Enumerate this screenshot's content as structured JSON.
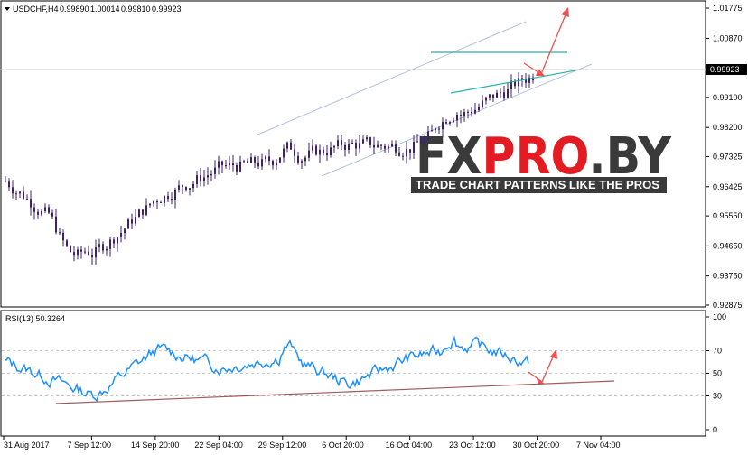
{
  "header": {
    "symbol": "USDCHF,H4",
    "open": "0.99890",
    "high": "1.00014",
    "low": "0.99810",
    "close": "0.99923",
    "current_price_label": "0.99923"
  },
  "rsi_header": "RSI(13) 50.3264",
  "watermark": {
    "brand_dark_1": "FX",
    "brand_red": "PRO",
    "brand_dark_2": ".BY",
    "tagline": "TRADE CHART PATTERNS LIKE THE PROS"
  },
  "colors": {
    "candle": "#3b1f7a",
    "rsi_line": "#1e90ff",
    "channel_line": "#b0c4de",
    "triangle_line": "#20b2aa",
    "trendline": "#a05a5a",
    "arrow": "#f05050",
    "grid": "#c8c8c8",
    "price_box": "#000000"
  },
  "chart_data": [
    {
      "type": "candlestick",
      "title": "USDCHF,H4",
      "ylim": [
        0.92875,
        1.01775
      ],
      "y_ticks": [
        "1.01775",
        "1.00870",
        "0.99923",
        "0.99100",
        "0.98200",
        "0.97325",
        "0.96425",
        "0.95550",
        "0.94650",
        "0.93750",
        "0.92875"
      ],
      "x_tick_labels": [
        "31 Aug 2017",
        "7 Sep 12:00",
        "14 Sep 20:00",
        "22 Sep 04:00",
        "29 Sep 12:00",
        "6 Oct 20:00",
        "16 Oct 04:00",
        "23 Oct 12:00",
        "30 Oct 20:00",
        "7 Nov 04:00"
      ],
      "approx_close_path": [
        {
          "x": "31 Aug 2017",
          "y": 0.966
        },
        {
          "x": "7 Sep 12:00",
          "y": 0.944
        },
        {
          "x": "14 Sep 20:00",
          "y": 0.961
        },
        {
          "x": "22 Sep 04:00",
          "y": 0.97
        },
        {
          "x": "29 Sep 12:00",
          "y": 0.972
        },
        {
          "x": "6 Oct 20:00",
          "y": 0.977
        },
        {
          "x": "16 Oct 04:00",
          "y": 0.976
        },
        {
          "x": "23 Oct 12:00",
          "y": 0.988
        },
        {
          "x": "30 Oct 20:00",
          "y": 0.999
        },
        {
          "x": "7 Nov 04:00",
          "y": 0.9992
        }
      ]
    },
    {
      "type": "line",
      "title": "RSI(13) 50.3264",
      "ylim": [
        0,
        100
      ],
      "y_ticks": [
        "100",
        "70",
        "50",
        "30",
        "0"
      ],
      "levels": [
        70,
        50,
        30
      ],
      "approx_path": [
        {
          "x": "31 Aug 2017",
          "y": 60
        },
        {
          "x": "7 Sep 12:00",
          "y": 30
        },
        {
          "x": "14 Sep 20:00",
          "y": 72
        },
        {
          "x": "22 Sep 04:00",
          "y": 55
        },
        {
          "x": "29 Sep 12:00",
          "y": 65
        },
        {
          "x": "6 Oct 20:00",
          "y": 40
        },
        {
          "x": "16 Oct 04:00",
          "y": 65
        },
        {
          "x": "23 Oct 12:00",
          "y": 75
        },
        {
          "x": "30 Oct 20:00",
          "y": 55
        },
        {
          "x": "7 Nov 04:00",
          "y": 50
        }
      ]
    }
  ]
}
